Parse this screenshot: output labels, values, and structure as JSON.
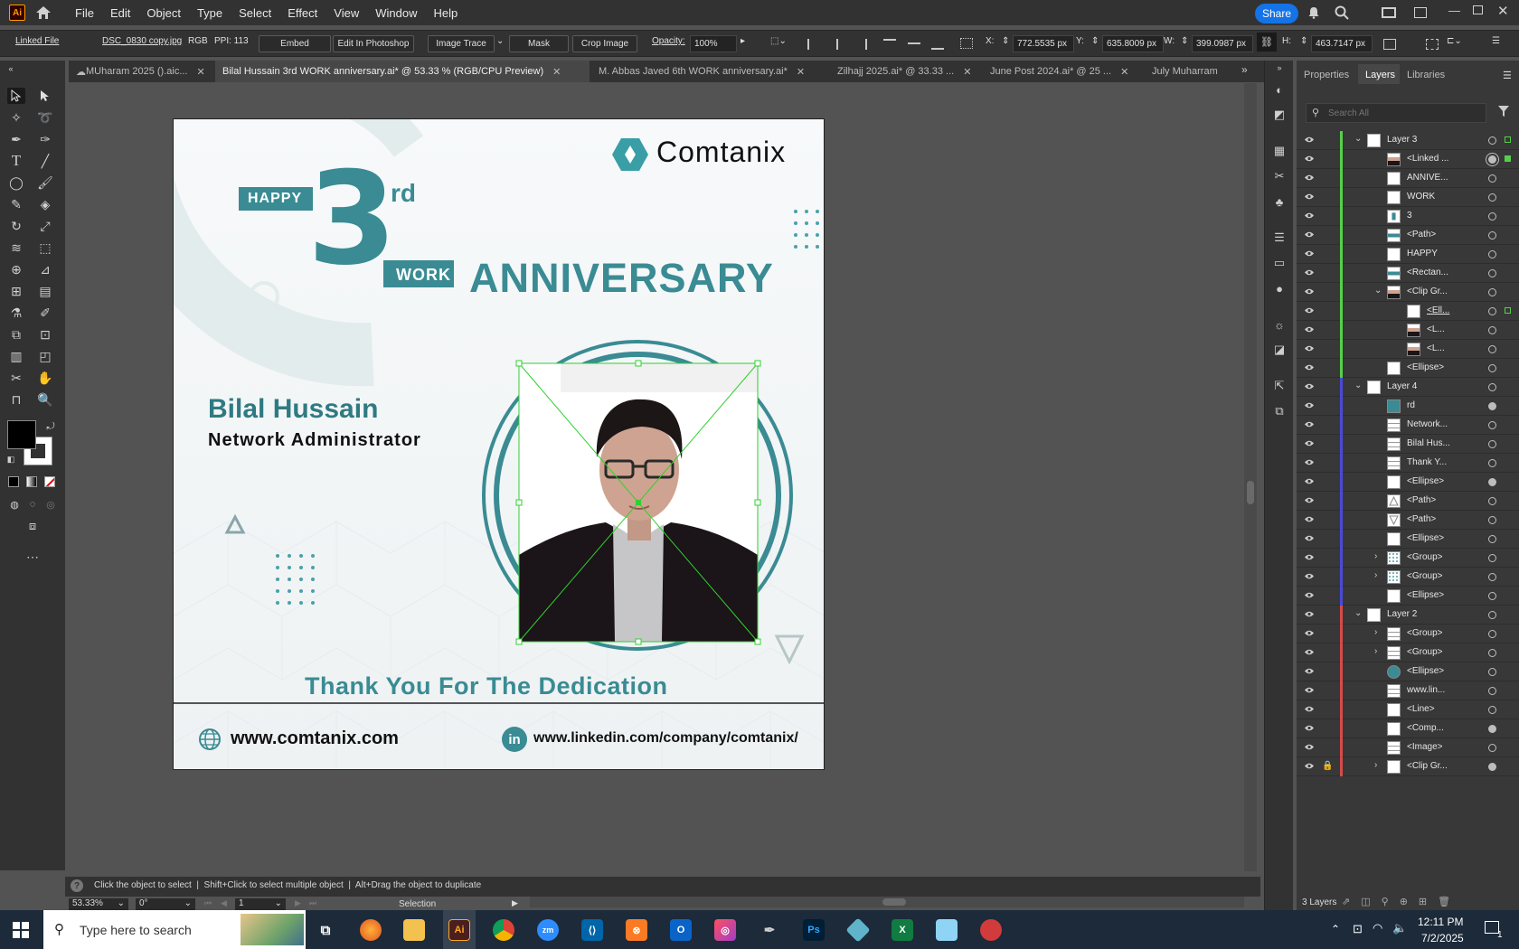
{
  "menubar": {
    "logo": "Ai",
    "items": [
      "File",
      "Edit",
      "Object",
      "Type",
      "Select",
      "Effect",
      "View",
      "Window",
      "Help"
    ],
    "share": "Share"
  },
  "controlbar": {
    "linked_file": "Linked File",
    "file_name": "DSC_0830 copy.jpg",
    "color_mode": "RGB",
    "ppi": "PPI: 113",
    "embed": "Embed",
    "edit_in_photoshop": "Edit In Photoshop",
    "image_trace": "Image Trace",
    "mask": "Mask",
    "crop_image": "Crop Image",
    "opacity_label": "Opacity:",
    "opacity_value": "100%",
    "x_label": "X:",
    "x_value": "772.5535 px",
    "y_label": "Y:",
    "y_value": "635.8009 px",
    "w_label": "W:",
    "w_value": "399.0987 px",
    "h_label": "H:",
    "h_value": "463.7147 px"
  },
  "tabs": [
    {
      "label": "MUharam 2025 ().aic..."
    },
    {
      "label": "Bilal Hussain  3rd  WORK anniversary.ai* @ 53.33 % (RGB/CPU Preview)"
    },
    {
      "label": "M. Abbas Javed  6th  WORK anniversary.ai*"
    },
    {
      "label": "Zilhajj 2025.ai* @ 33.33 ..."
    },
    {
      "label": "June Post 2024.ai* @ 25 ..."
    },
    {
      "label": "July Muharram"
    }
  ],
  "artwork": {
    "brand": "Comtanix",
    "happy": "HAPPY",
    "number": "3",
    "suffix": "rd",
    "work": "WORK",
    "anniversary": "ANNIVERSARY",
    "name": "Bilal Hussain",
    "role": "Network Administrator",
    "thanks": "Thank You For The Dedication",
    "website": "www.comtanix.com",
    "linkedin_badge": "in",
    "linkedin": "www.linkedin.com/company/comtanix/",
    "colors": {
      "teal": "#3a8b93",
      "dark_teal": "#2f7a82",
      "light_teal": "#e3eced"
    }
  },
  "panel": {
    "tabs": [
      "Properties",
      "Layers",
      "Libraries"
    ],
    "search_placeholder": "Search All",
    "layers": [
      {
        "name": "Layer 3",
        "level": 0,
        "color": "#56d04a",
        "twisty": "down",
        "thumb": "page"
      },
      {
        "name": "<Linked ...",
        "level": 2,
        "color": "#56d04a",
        "thumb": "photo"
      },
      {
        "name": "ANNIVE...",
        "level": 2,
        "color": "#56d04a",
        "thumb": "blank"
      },
      {
        "name": "WORK",
        "level": 2,
        "color": "#56d04a",
        "thumb": "blank"
      },
      {
        "name": "3",
        "level": 2,
        "color": "#56d04a",
        "thumb": "three"
      },
      {
        "name": "<Path>",
        "level": 2,
        "color": "#56d04a",
        "thumb": "teal-stripe"
      },
      {
        "name": "HAPPY",
        "level": 2,
        "color": "#56d04a",
        "thumb": "blank"
      },
      {
        "name": "<Rectan...",
        "level": 2,
        "color": "#56d04a",
        "thumb": "teal-stripe"
      },
      {
        "name": "<Clip Gr...",
        "level": 2,
        "color": "#56d04a",
        "twisty": "down",
        "thumb": "photo"
      },
      {
        "name": "<Ell...",
        "level": 3,
        "color": "#56d04a",
        "thumb": "blank"
      },
      {
        "name": "<L...",
        "level": 3,
        "color": "#56d04a",
        "thumb": "photo"
      },
      {
        "name": "<L...",
        "level": 3,
        "color": "#56d04a",
        "thumb": "photo"
      },
      {
        "name": "<Ellipse>",
        "level": 2,
        "color": "#56d04a",
        "thumb": "blank"
      },
      {
        "name": "Layer 4",
        "level": 0,
        "color": "#4a4ad6",
        "twisty": "down",
        "thumb": "page"
      },
      {
        "name": "rd",
        "level": 2,
        "color": "#4a4ad6",
        "thumb": "rd"
      },
      {
        "name": "Network...",
        "level": 2,
        "color": "#4a4ad6",
        "thumb": "lines"
      },
      {
        "name": "Bilal Hus...",
        "level": 2,
        "color": "#4a4ad6",
        "thumb": "lines"
      },
      {
        "name": "Thank Y...",
        "level": 2,
        "color": "#4a4ad6",
        "thumb": "lines"
      },
      {
        "name": "<Ellipse>",
        "level": 2,
        "color": "#4a4ad6",
        "thumb": "blank"
      },
      {
        "name": "<Path>",
        "level": 2,
        "color": "#4a4ad6",
        "thumb": "tri-up"
      },
      {
        "name": "<Path>",
        "level": 2,
        "color": "#4a4ad6",
        "thumb": "tri-down"
      },
      {
        "name": "<Ellipse>",
        "level": 2,
        "color": "#4a4ad6",
        "thumb": "blank"
      },
      {
        "name": "<Group>",
        "level": 2,
        "color": "#4a4ad6",
        "twisty": "right",
        "thumb": "dots"
      },
      {
        "name": "<Group>",
        "level": 2,
        "color": "#4a4ad6",
        "twisty": "right",
        "thumb": "dots"
      },
      {
        "name": "<Ellipse>",
        "level": 2,
        "color": "#4a4ad6",
        "thumb": "blank"
      },
      {
        "name": "Layer 2",
        "level": 0,
        "color": "#d64a4a",
        "twisty": "down",
        "thumb": "page"
      },
      {
        "name": "<Group>",
        "level": 2,
        "color": "#d64a4a",
        "twisty": "right",
        "thumb": "lines"
      },
      {
        "name": "<Group>",
        "level": 2,
        "color": "#d64a4a",
        "twisty": "right",
        "thumb": "lines"
      },
      {
        "name": "<Ellipse>",
        "level": 2,
        "color": "#d64a4a",
        "thumb": "teal-circle"
      },
      {
        "name": "www.lin...",
        "level": 2,
        "color": "#d64a4a",
        "thumb": "lines"
      },
      {
        "name": "<Line>",
        "level": 2,
        "color": "#d64a4a",
        "thumb": "blank"
      },
      {
        "name": "<Comp...",
        "level": 2,
        "color": "#d64a4a",
        "thumb": "blank"
      },
      {
        "name": "<Image>",
        "level": 2,
        "color": "#d64a4a",
        "thumb": "lines"
      },
      {
        "name": "<Clip Gr...",
        "level": 2,
        "color": "#d64a4a",
        "twisty": "right",
        "thumb": "blank",
        "locked": true
      }
    ],
    "footer": "3 Layers"
  },
  "status": {
    "hint": "Click the object to select  |  Shift+Click to select multiple object  |  Alt+Drag the object to duplicate",
    "zoom": "53.33%",
    "rotation": "0°",
    "artboard": "1",
    "tool": "Selection"
  },
  "taskbar": {
    "search_placeholder": "Type here to search",
    "time": "12:11 PM",
    "date": "7/2/2025",
    "notification_count": "1"
  }
}
